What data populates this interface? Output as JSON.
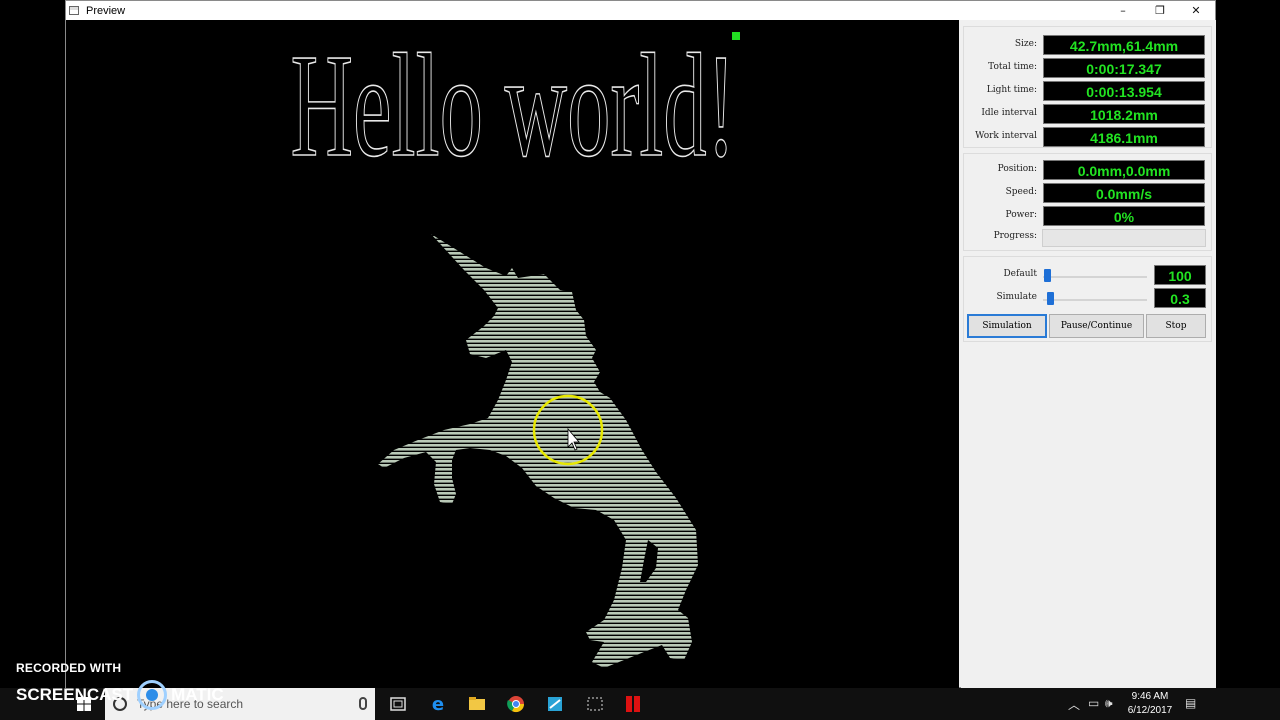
{
  "window": {
    "title": "Preview",
    "controls": {
      "minimize": "–",
      "restore": "❐",
      "close": "✕"
    }
  },
  "canvas": {
    "headline": "Hello world!",
    "shape_icon": "unicorn-silhouette-icon",
    "hatch_color": "#b9c9b7",
    "marker_color": "#22dd22",
    "cursor_highlight_color": "#e8e800"
  },
  "stats": {
    "size_label": "Size:",
    "size": "42.7mm,61.4mm",
    "total_time_label": "Total time:",
    "total_time": "0:00:17.347",
    "light_time_label": "Light time:",
    "light_time": "0:00:13.954",
    "idle_interval_label": "Idle interval",
    "idle_interval": "1018.2mm",
    "work_interval_label": "Work interval",
    "work_interval": "4186.1mm"
  },
  "status": {
    "position_label": "Position:",
    "position": "0.0mm,0.0mm",
    "speed_label": "Speed:",
    "speed": "0.0mm/s",
    "power_label": "Power:",
    "power": "0%",
    "progress_label": "Progress:",
    "progress_value": 0
  },
  "sliders": {
    "default_label": "Default",
    "default_value": "100",
    "default_level": 0.0,
    "simulate_label": "Simulate",
    "simulate_value": "0.3",
    "simulate_level": 0.03
  },
  "buttons": {
    "simulation": "Simulation",
    "pause_continue": "Pause/Continue",
    "stop": "Stop"
  },
  "watermark": {
    "line1": "RECORDED WITH",
    "left": "SCREENCAST",
    "right": "MATIC"
  },
  "taskbar": {
    "search_placeholder": "Type here to search",
    "time": "9:46 AM",
    "date": "6/12/2017",
    "apps": [
      "task-view-icon",
      "edge-icon",
      "file-explorer-icon",
      "chrome-icon",
      "app-icon",
      "snipping-icon",
      "laser-app-icon"
    ]
  }
}
